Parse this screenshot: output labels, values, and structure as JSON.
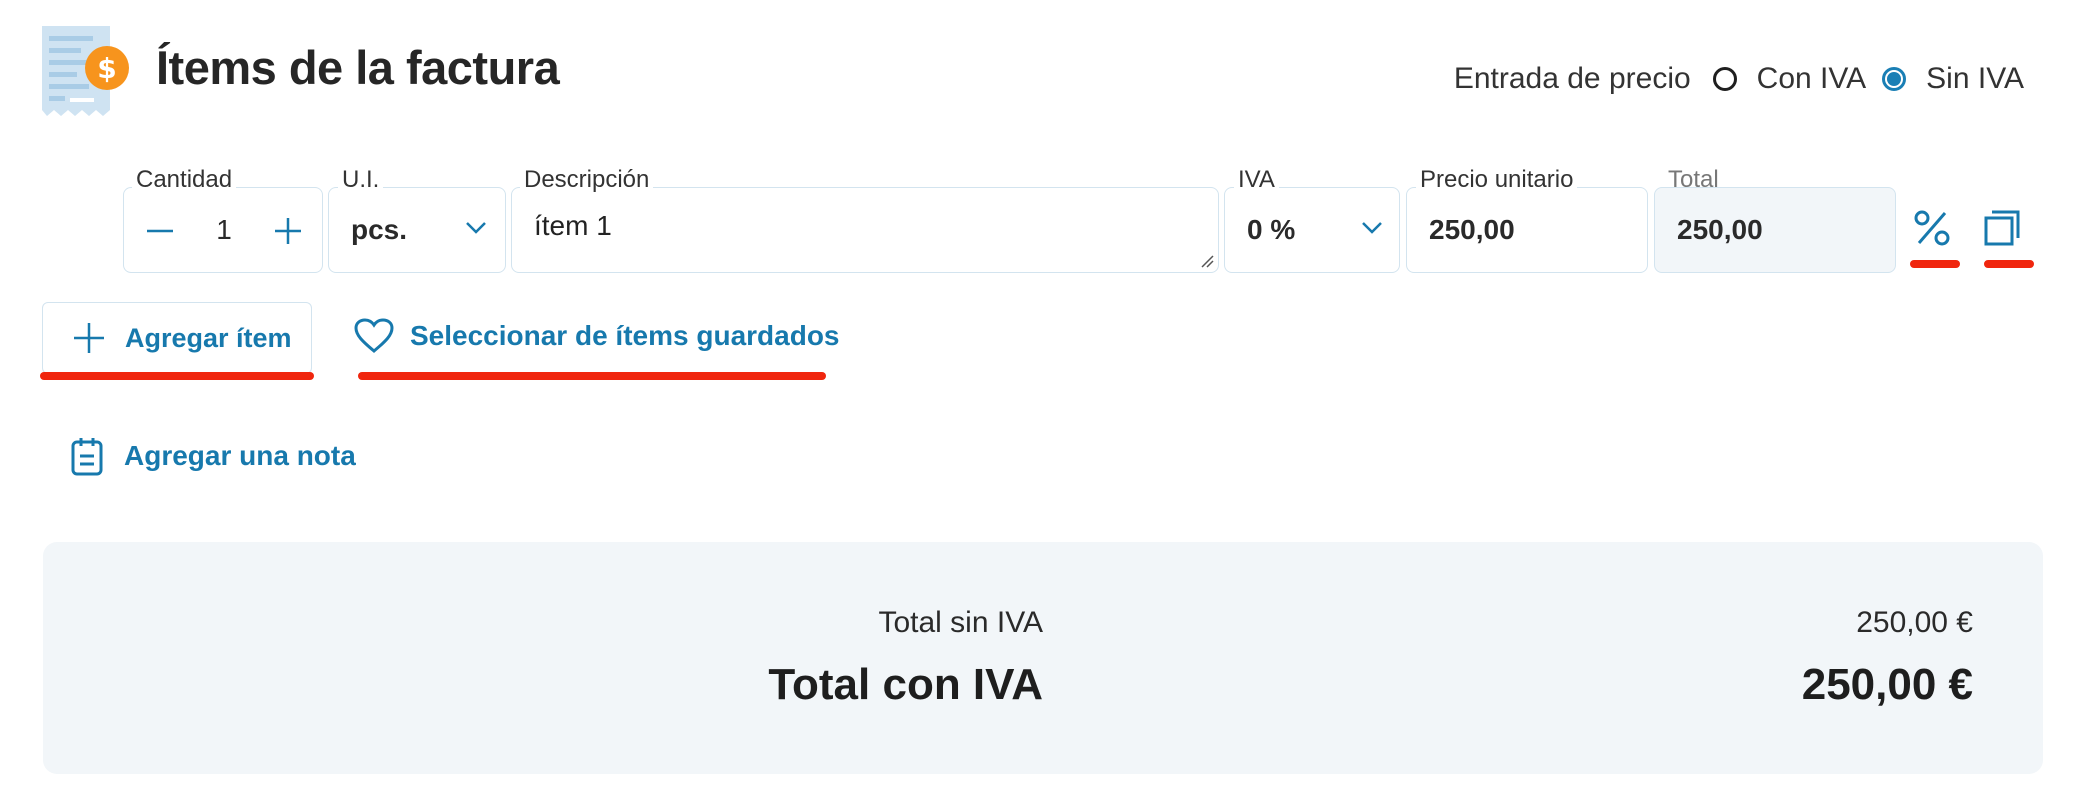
{
  "header": {
    "title": "Ítems de la factura",
    "icon": "invoice-dollar-icon",
    "price_entry": {
      "label": "Entrada de precio",
      "options": [
        "Con IVA",
        "Sin IVA"
      ],
      "selected": "Sin IVA"
    }
  },
  "item_row": {
    "quantity": {
      "label": "Cantidad",
      "value": "1",
      "decrement_icon": "minus-icon",
      "increment_icon": "plus-icon"
    },
    "unit": {
      "label": "U.I.",
      "value": "pcs."
    },
    "description": {
      "label": "Descripción",
      "value": "ítem 1"
    },
    "vat": {
      "label": "IVA",
      "value": "0 %"
    },
    "unit_price": {
      "label": "Precio unitario",
      "value": "250,00"
    },
    "total": {
      "label": "Total",
      "value": "250,00"
    },
    "actions": [
      "percent-icon",
      "copy-icon"
    ]
  },
  "actions": {
    "add_item": "Agregar ítem",
    "select_saved": "Seleccionar de ítems guardados",
    "add_note": "Agregar una nota"
  },
  "totals": {
    "without_vat_label": "Total sin IVA",
    "without_vat_value": "250,00 €",
    "with_vat_label": "Total con IVA",
    "with_vat_value": "250,00 €"
  },
  "colors": {
    "accent": "#1779ad",
    "annotation": "#f0260e",
    "panel": "#f2f6f9",
    "field_border": "#d3e4ef"
  }
}
